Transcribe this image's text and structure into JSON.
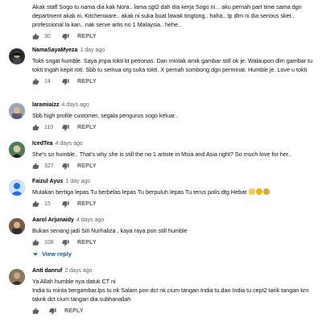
{
  "comments": [
    {
      "author": "",
      "date": "",
      "text": "Akak staff Sogo tu nama dia kak Nora.. lama sgt2 dah dia kerja Sogo ni... aku pernah part time sama dgn department akak ni, Kitchenware.. akak ni suka buat lawak tingtong.. haha.. tp dlm ni dia serious sket.. professional la kan.. nak serve artis no 1 Malaysia.. hehe..",
      "likes": "30",
      "reply_label": "REPLY"
    },
    {
      "author": "NamaSayaMyeza",
      "date": "1 day ago",
      "text": "Tokti sngat humble. Saya jmpa tokti kt petronas. Dan mintak amik gambar still ok je. Walaupon dlm gambar tu tokti tngah kepit roti. Sbb tu semua org suka tokti. X pernah sombong dgn perminat. Humble je. Love u tokti",
      "likes": "14",
      "reply_label": "REPLY",
      "avatar_color": "#2b2b2b"
    },
    {
      "author": "laramiaizz",
      "date": "4 days ago",
      "text": "Sbb high profile customer, segala pengurus sogo keluar..",
      "likes": "110",
      "reply_label": "REPLY",
      "avatar_color": "#8a8f99"
    },
    {
      "author": "IcedTea",
      "date": "4 days ago",
      "text": "She's so humble.. That's why she is still the no 1 artiste in Msia and Asia right? So much love for her..",
      "likes": "327",
      "reply_label": "REPLY",
      "avatar_color": "#3d6b45"
    },
    {
      "author": "Faizul Ayus",
      "date": "1 day ago",
      "text": "Mulakan bertiga lepas Tu berbelas lepas Tu berpuluh lepas Tu terus polis dtg Hebat",
      "likes": "15",
      "reply_label": "REPLY",
      "avatar_color": "#1a73e8"
    },
    {
      "author": "Aarol Arjunaidy",
      "date": "4 days ago",
      "text": "Bukan senang jadi Siti Nurhaliza , kaya raya pon still humble",
      "likes": "108",
      "reply_label": "REPLY",
      "view_reply": "View reply",
      "avatar_color": "#6b4a3a"
    },
    {
      "author": "Anti danruf",
      "date": "2 days ago",
      "text": "Ya Allah humble nya datuk CT ni\nIndia tu minta bergambar.lps tu nk Salam pon dct nk cium tangan India tu.dan India tu cept2 tarik tangan krn taknk dct cium tangan dia.subhanallah",
      "likes": "",
      "reply_label": "REPLY",
      "avatar_color": "#7a6a55"
    }
  ],
  "icons": {
    "like": "thumbs-up-icon",
    "dislike": "thumbs-down-icon",
    "expand": "caret-down-icon",
    "emoji": [
      "thumbs-up-emoji",
      "smiling-face-emoji",
      "clapping-hands-emoji"
    ]
  },
  "colors": {
    "link_blue": "#065fd4",
    "secondary_text": "#606060"
  }
}
